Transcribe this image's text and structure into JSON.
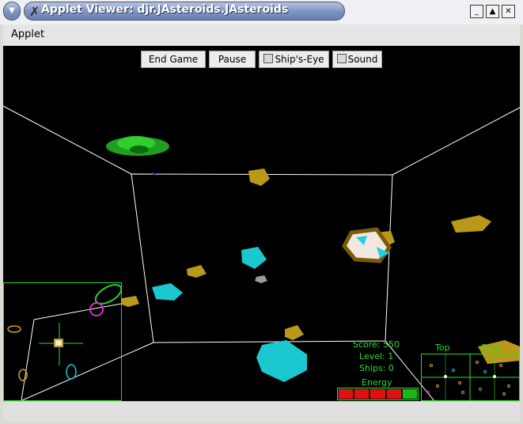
{
  "window": {
    "title": "Applet Viewer: djr.JAsteroids.JAsteroids",
    "min_glyph": "_",
    "max_glyph": "▲",
    "close_glyph": "✕"
  },
  "menubar": {
    "applet_label": "Applet"
  },
  "controls": {
    "end_game_label": "End Game",
    "pause_label": "Pause",
    "ships_eye_label": "Ship's-Eye",
    "sound_label": "Sound",
    "ships_eye_checked": false,
    "sound_checked": false
  },
  "hud": {
    "score_text": "Score: 550",
    "level_text": "Level: 1",
    "ships_text": "Ships: 0",
    "energy_label": "Energy",
    "energy_cells": 5,
    "energy_cells_on": 1,
    "top_label": "Top",
    "side_label": "Side"
  },
  "colors": {
    "hud_green": "#2bdc2b",
    "asteroid_gold": "#b89a18",
    "asteroid_cyan": "#1bc8cf",
    "ship_green": "#1faa1f",
    "energy_red": "#e01010",
    "title_blue": "#7e92bf"
  },
  "icons": {
    "window_menu": "chevron-down-icon",
    "app_logo": "x-logo-icon",
    "minimize": "minimize-icon",
    "maximize": "maximize-icon",
    "close": "close-icon"
  }
}
